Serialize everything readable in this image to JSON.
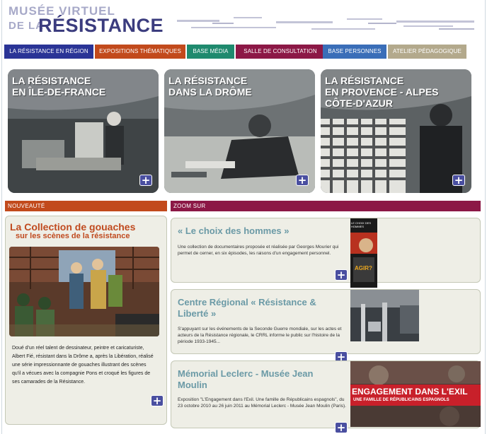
{
  "logo": {
    "line1": "MUSÉE VIRTUEL",
    "line2a": "DE LA",
    "line2b": "RÉSISTANCE"
  },
  "nav": [
    {
      "label": "LA RÉSISTANCE EN RÉGION",
      "color": "#2a3496"
    },
    {
      "label": "EXPOSITIONS THÉMATIQUES",
      "color": "#c24a1c"
    },
    {
      "label": "BASE MÉDIA",
      "color": "#1f8a6e"
    },
    {
      "label": "SALLE DE CONSULTATION",
      "color": "#8c1846"
    },
    {
      "label": "BASE PERSONNES",
      "color": "#3a6eb8"
    },
    {
      "label": "ATELIER PÉDAGOGIQUE",
      "color": "#b3a98c"
    }
  ],
  "regions": [
    {
      "line1": "LA RÉSISTANCE",
      "line2": "EN ÎLE-DE-FRANCE",
      "line3": ""
    },
    {
      "line1": "LA RÉSISTANCE",
      "line2": "DANS LA DRÔME",
      "line3": ""
    },
    {
      "line1": "LA RÉSISTANCE",
      "line2": "EN PROVENCE - ALPES",
      "line3": "CÔTE-D'AZUR"
    }
  ],
  "plus_symbol": "+",
  "nouveaute": {
    "header": "NOUVEAUTÉ",
    "title1": "La Collection de gouaches",
    "title2": "sur les scènes de la résistance",
    "text": "Doué d'un réel talent de dessinateur, peintre et caricaturiste, Albert Fié, résistant dans la Drôme  a, après la Libération, réalisé une série impressionnante de gouaches illustrant des scènes qu'il a vécues avec la compagnie Pons et croqué les figures de ses camarades de la Résistance."
  },
  "zoom": {
    "header": "ZOOM SUR",
    "items": [
      {
        "title": "« Le choix des hommes »",
        "text": "Une collection de documentaires proposée et réalisée par Georges Mourier qui permet de cerner, en six épisodes, les raisons d'un engagement personnel.",
        "image_text1": "LE CHOIX DES HOMMES",
        "image_text2": "AGIR?"
      },
      {
        "title": "Centre Régional « Résistance & Liberté »",
        "text": "S'appuyant sur les événements de la Seconde Guerre mondiale, sur les actes et acteurs de la Résistance régionale, le CRRL informe le public sur l'histoire de la période 1933-1945...",
        "image_text1": "",
        "image_text2": ""
      },
      {
        "title": "Mémorial Leclerc - Musée Jean Moulin",
        "text": "Exposition \"L'Engagement dans l'Exil. Une famille de Républicains espagnols\", du 23 octobre 2010 au 26 juin 2011 au Mémorial Leclerc - Musée Jean Moulin (Paris).",
        "image_text1": "ENGAGEMENT DANS L'EXIL",
        "image_text2": "UNE FAMILLE DE RÉPUBLICAINS ESPAGNOLS"
      }
    ]
  },
  "colors": {
    "nouveaute_header": "#c24a1c",
    "zoom_header": "#8c1846",
    "title_orange": "#c04a1f",
    "zoom_title": "#6b9aa6"
  }
}
